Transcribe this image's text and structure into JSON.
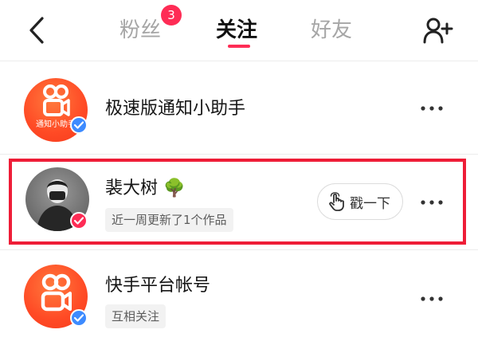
{
  "header": {
    "tabs": [
      {
        "label": "粉丝",
        "badge": "3",
        "active": false
      },
      {
        "label": "关注",
        "active": true
      },
      {
        "label": "好友",
        "active": false
      }
    ],
    "back_icon": "chevron-left-icon",
    "add_friend_icon": "add-user-icon",
    "accent_color": "#fe2c55"
  },
  "list": {
    "items": [
      {
        "name": "极速版通知小助手",
        "avatar_caption": "通知小助手",
        "verified": "blue",
        "more_icon": "more-horizontal-icon"
      },
      {
        "name": "裴大树",
        "name_emoji": "🌳",
        "tag": "近一周更新了1个作品",
        "verified": "pink",
        "poke_label": "戳一下",
        "poke_icon": "tap-hand-icon",
        "highlighted": true,
        "more_icon": "more-horizontal-icon"
      },
      {
        "name": "快手平台帐号",
        "tag": "互相关注",
        "verified": "blue",
        "more_icon": "more-horizontal-icon"
      }
    ]
  },
  "colors": {
    "verified_blue": "#3d8bff",
    "highlight_red": "#ee1d37"
  }
}
